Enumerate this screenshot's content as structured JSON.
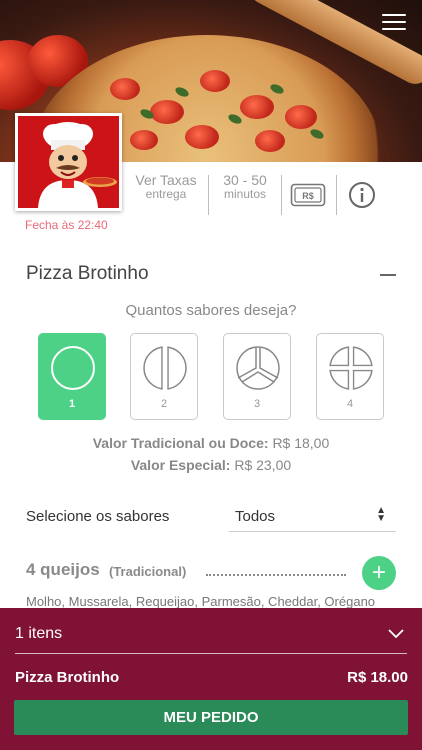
{
  "header": {
    "menu_icon": "hamburger-icon"
  },
  "restaurant": {
    "logo_icon": "chef-logo",
    "closes_at": "Fecha às 22:40",
    "fees": {
      "label": "Ver Taxas",
      "sub": "entrega"
    },
    "time": {
      "label": "30 - 50",
      "sub": "minutos"
    },
    "payment_icon": "money-icon",
    "info_icon": "info-icon"
  },
  "product": {
    "title": "Pizza Brotinho",
    "question": "Quantos sabores deseja?",
    "flavors": [
      {
        "count": "1",
        "selected": true
      },
      {
        "count": "2",
        "selected": false
      },
      {
        "count": "3",
        "selected": false
      },
      {
        "count": "4",
        "selected": false
      }
    ],
    "prices": [
      {
        "label": "Valor Tradicional ou Doce:",
        "value": "R$ 18,00"
      },
      {
        "label": "Valor Especial:",
        "value": "R$ 23,00"
      }
    ]
  },
  "filter": {
    "label": "Selecione os sabores",
    "value": "Todos"
  },
  "menu_item": {
    "name": "4 queijos",
    "type": "(Tradicional)",
    "description": "Molho, Mussarela, Requeijao, Parmesão, Cheddar, Orégano",
    "add_icon": "plus-icon"
  },
  "cart": {
    "count": "1 itens",
    "item_name": "Pizza Brotinho",
    "item_price": "R$ 18.00",
    "button": "MEU PEDIDO"
  },
  "colors": {
    "accent_green": "#4dd187",
    "footer": "#7f1235",
    "button": "#2a8a58",
    "closes": "#e86a7a"
  }
}
